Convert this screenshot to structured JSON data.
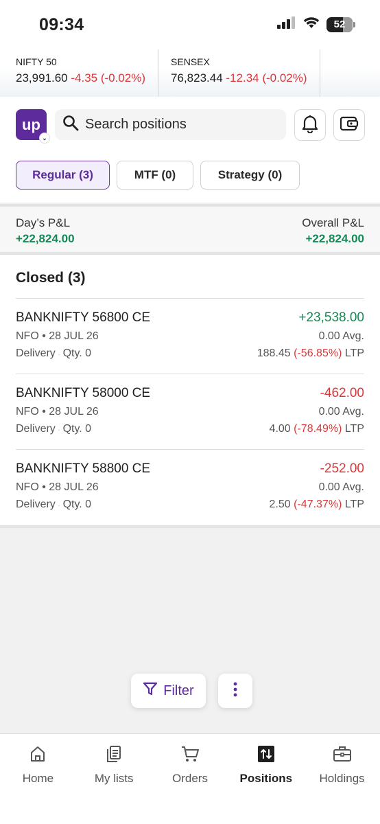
{
  "status_bar": {
    "time": "09:34",
    "battery": "52"
  },
  "ticker": [
    {
      "name": "NIFTY 50",
      "value": "23,991.60",
      "change": "-4.35 (-0.02%)"
    },
    {
      "name": "SENSEX",
      "value": "76,823.44",
      "change": "-12.34 (-0.02%)"
    }
  ],
  "header": {
    "logo_text": "up",
    "search_placeholder": "Search positions"
  },
  "tabs": [
    {
      "label": "Regular (3)",
      "active": true
    },
    {
      "label": "MTF (0)",
      "active": false
    },
    {
      "label": "Strategy (0)",
      "active": false
    }
  ],
  "pnl": {
    "day_label": "Day’s P&L",
    "day_value": "+22,824.00",
    "overall_label": "Overall P&L",
    "overall_value": "+22,824.00"
  },
  "section_title": "Closed (3)",
  "positions": [
    {
      "symbol": "BANKNIFTY 56800 CE",
      "exchange": "NFO • 28 JUL 26",
      "product": "Delivery",
      "qty": "Qty. 0",
      "pl": "+23,538.00",
      "avg": "0.00 Avg.",
      "ltp_value": "188.45",
      "ltp_change": "(-56.85%)",
      "ltp_suffix": "LTP"
    },
    {
      "symbol": "BANKNIFTY 58000 CE",
      "exchange": "NFO • 28 JUL 26",
      "product": "Delivery",
      "qty": "Qty. 0",
      "pl": "-462.00",
      "avg": "0.00 Avg.",
      "ltp_value": "4.00",
      "ltp_change": "(-78.49%)",
      "ltp_suffix": "LTP"
    },
    {
      "symbol": "BANKNIFTY 58800 CE",
      "exchange": "NFO • 28 JUL 26",
      "product": "Delivery",
      "qty": "Qty. 0",
      "pl": "-252.00",
      "avg": "0.00 Avg.",
      "ltp_value": "2.50",
      "ltp_change": "(-47.37%)",
      "ltp_suffix": "LTP"
    }
  ],
  "floating": {
    "filter_label": "Filter"
  },
  "bottom_nav": [
    {
      "label": "Home",
      "icon": "home-icon"
    },
    {
      "label": "My lists",
      "icon": "lists-icon"
    },
    {
      "label": "Orders",
      "icon": "cart-icon"
    },
    {
      "label": "Positions",
      "icon": "positions-icon",
      "active": true
    },
    {
      "label": "Holdings",
      "icon": "briefcase-icon"
    }
  ],
  "colors": {
    "brand": "#5d2b9c",
    "positive": "#138a55",
    "negative": "#d8383a"
  }
}
